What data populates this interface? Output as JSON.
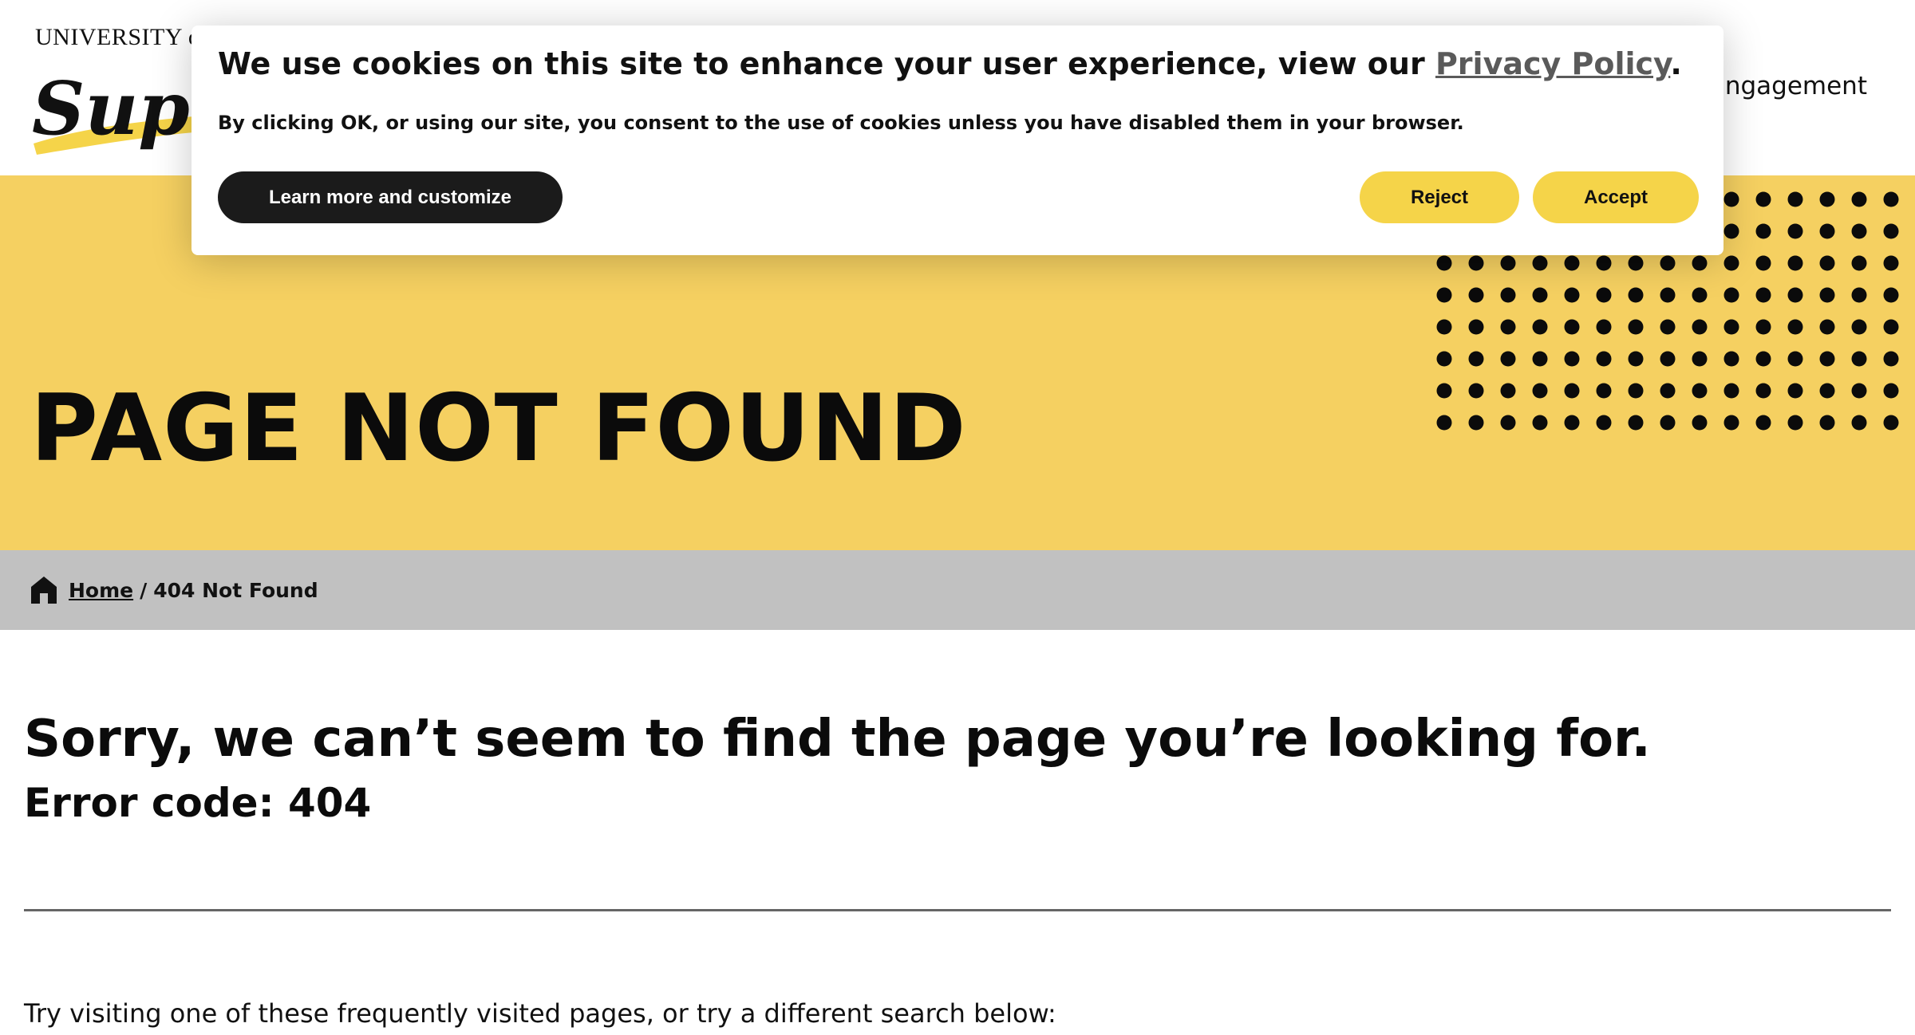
{
  "header": {
    "logo_top_text": "UNIVERSITY o",
    "logo_script_text": "Sup",
    "nav_partial_label": "ngagement"
  },
  "hero": {
    "title": "PAGE NOT FOUND",
    "background_color": "#f5d061"
  },
  "breadcrumb": {
    "home_icon": "home-icon",
    "home_label": "Home",
    "separator": "/",
    "current": "404 Not Found"
  },
  "main": {
    "heading": "Sorry, we can’t seem to find the page you’re looking for.",
    "error_code": "Error code: 404",
    "suggestion_text": "Try visiting one of these frequently visited pages, or try a different search below:"
  },
  "cookie_banner": {
    "heading_prefix": "We use cookies on this site to enhance your user experience, view our",
    "privacy_link": "Privacy Policy",
    "heading_suffix": ".",
    "body": "By clicking OK, or using our site, you consent to the use of cookies unless you have disabled them in your browser.",
    "learn_more_label": "Learn more and customize",
    "reject_label": "Reject",
    "accept_label": "Accept",
    "accent_color": "#f5d449"
  }
}
